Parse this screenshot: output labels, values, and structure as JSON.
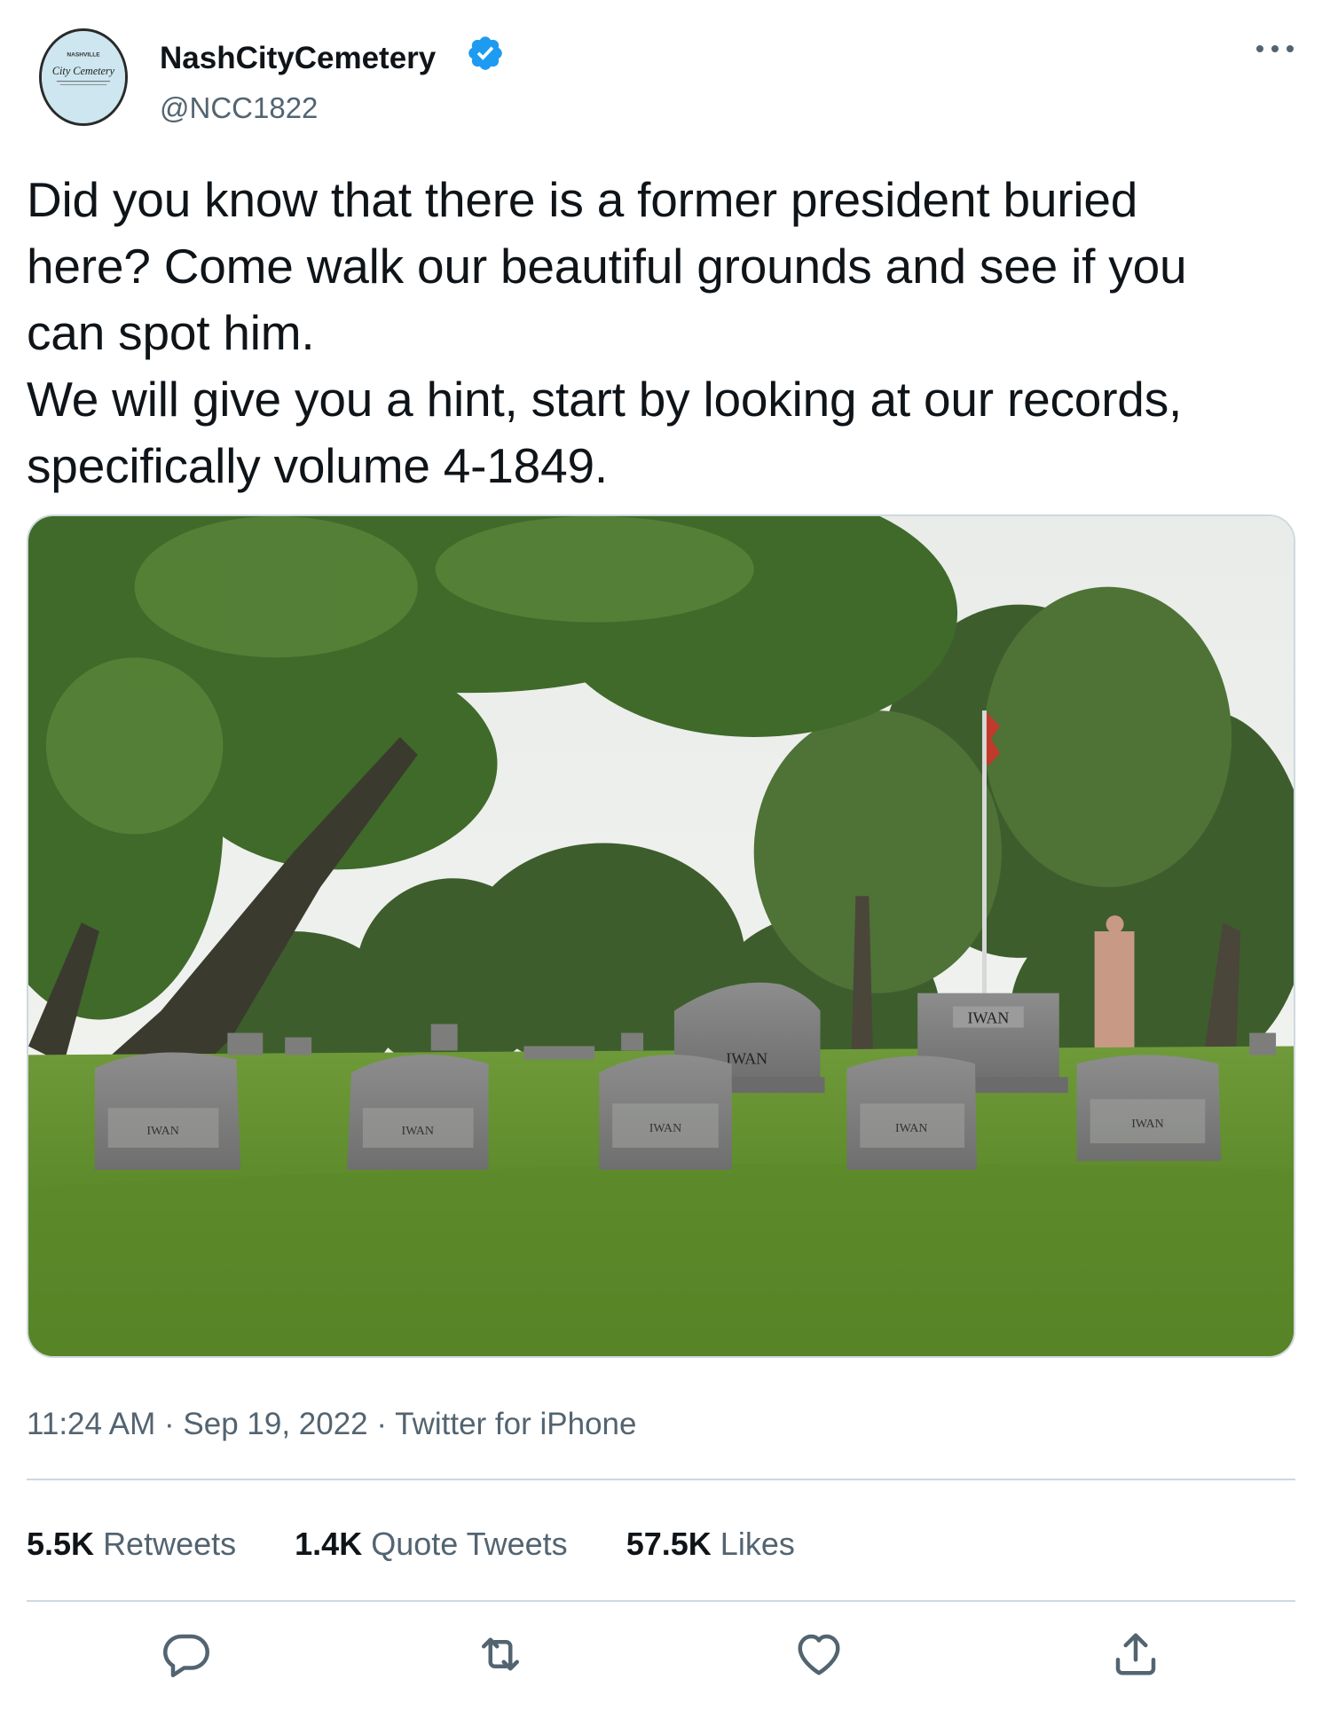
{
  "tweet": {
    "author_name": "NashCityCemetery",
    "handle": "@NCC1822",
    "avatar_text": {
      "top": "NASHVILLE",
      "main": "City Cemetery"
    },
    "text": "Did you know that there is a former president buried\nhere? Come walk our beautiful grounds and see if you\ncan spot him.\nWe will give you a hint, start by looking at our records,\nspecifically volume 4-1849.",
    "image_text": {
      "monument_left": "IWAN",
      "monument_right": "IWAN",
      "headstones": [
        "IWAN",
        "IWAN",
        "IWAN",
        "IWAN",
        "IWAN"
      ]
    },
    "time": "11:24 AM",
    "separator": "·",
    "date": "Sep 19, 2022",
    "source": "Twitter for iPhone"
  },
  "stats": {
    "retweets_count": "5.5K",
    "retweets_label": "Retweets",
    "quotes_count": "1.4K",
    "quotes_label": "Quote Tweets",
    "likes_count": "57.5K",
    "likes_label": "Likes"
  },
  "icons": {
    "verified": "verified-badge-icon",
    "more": "more-icon",
    "reply": "reply-icon",
    "retweet": "retweet-icon",
    "like": "heart-icon",
    "share": "share-icon"
  },
  "colors": {
    "text": "#0f1419",
    "secondary": "#536471",
    "verified": "#1d9bf0",
    "divider": "#cfd9de"
  }
}
